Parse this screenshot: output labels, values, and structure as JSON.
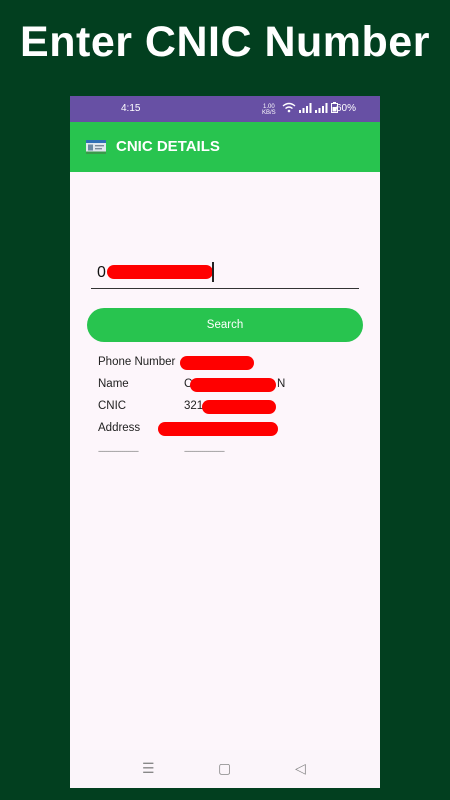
{
  "banner": {
    "title": "Enter CNIC Number"
  },
  "status_bar": {
    "time": "4:15",
    "net_speed": "1.00",
    "net_unit": "KB/S",
    "battery": "60%"
  },
  "app_bar": {
    "title": "CNIC DETAILS",
    "logo_icon": "cnic-card-icon"
  },
  "search": {
    "input_value": "0",
    "button_label": "Search"
  },
  "details": {
    "rows": [
      {
        "label": "Phone Number",
        "value": ""
      },
      {
        "label": "Name",
        "value": "C",
        "suffix": "N"
      },
      {
        "label": "CNIC",
        "value": "321"
      },
      {
        "label": "Address",
        "value": ""
      }
    ],
    "placeholder_left": "--------------------",
    "placeholder_right": "--------------------"
  },
  "nav": {
    "menu_icon": "☰",
    "home_icon": "▢",
    "back_icon": "◁"
  },
  "colors": {
    "background": "#023f1f",
    "accent": "#28c44f",
    "status_bar": "#6750a4",
    "redaction": "#ff0000"
  }
}
